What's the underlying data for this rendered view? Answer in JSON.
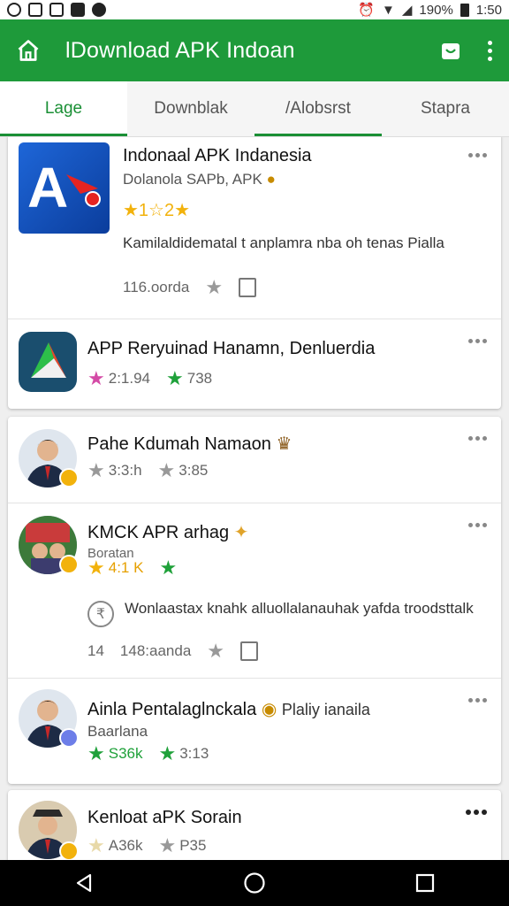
{
  "status_bar": {
    "battery": "190%",
    "time": "1:50"
  },
  "app_bar": {
    "title": "lDownload APK Indoan"
  },
  "tabs": [
    {
      "label": "Lage"
    },
    {
      "label": "Downblak"
    },
    {
      "label": "/Alobsrst"
    },
    {
      "label": "Stapra"
    }
  ],
  "featured": {
    "name": "Indonaal APK Indanesia",
    "subtitle": "Dolanola SAPb, APK",
    "rating": "★1☆2★",
    "description": "Kamilaldidematal t anplamra nba oh tenas Pialla",
    "size": "116.oorda"
  },
  "app_row": {
    "name": "APP Reryuinad Hanamn, Denluerdia",
    "rating": "2:1.94",
    "score": "738"
  },
  "items": [
    {
      "name": "Pahe Kdumah Namaon",
      "rating": "3:3:h",
      "score": "3:85"
    },
    {
      "name": "KMCK APR arhag",
      "subtitle": "Boratan",
      "rating": "4:1 K",
      "description": "Wonlaastax knahk alluollalanauhak yafda troodsttalk",
      "size_prefix": "14",
      "size": "148:aanda"
    },
    {
      "name": "Ainla Pentalaglnckala",
      "extra": "Plaliy ianaila",
      "subtitle": "Baarlana",
      "rating": "S36k",
      "score": "3:13"
    }
  ],
  "last_item": {
    "name": "Kenloat aPK Sorain",
    "rating": "A36k",
    "score": "P35"
  }
}
